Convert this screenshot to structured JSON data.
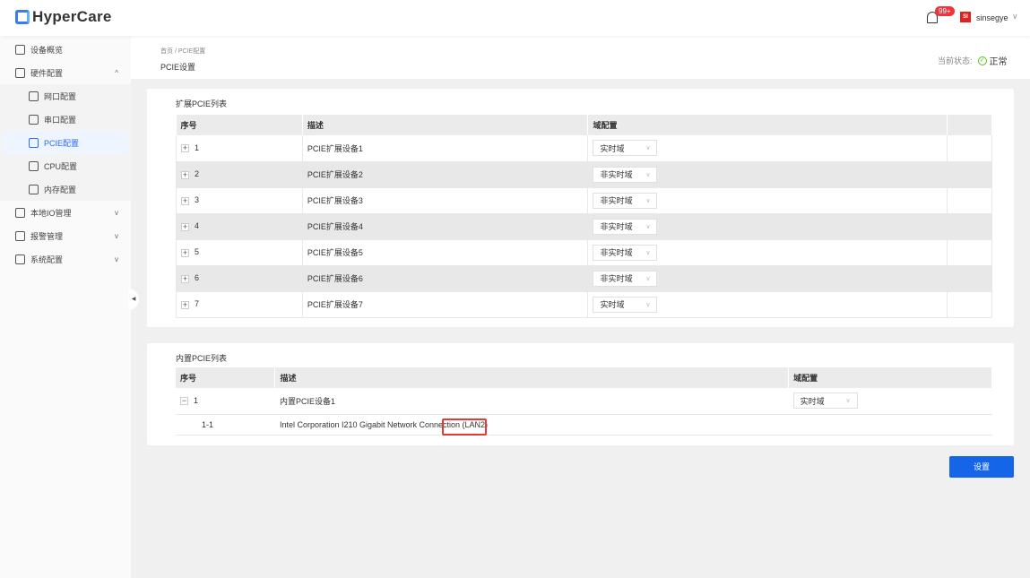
{
  "header": {
    "app_name": "HyperCare",
    "notification_count": "99+",
    "avatar_text": "SI",
    "username": "sinsegye"
  },
  "sidebar": {
    "items": [
      {
        "label": "设备概览"
      },
      {
        "label": "硬件配置"
      },
      {
        "label": "网口配置"
      },
      {
        "label": "串口配置"
      },
      {
        "label": "PCIE配置"
      },
      {
        "label": "CPU配置"
      },
      {
        "label": "内存配置"
      },
      {
        "label": "本地IO管理"
      },
      {
        "label": "报警管理"
      },
      {
        "label": "系统配置"
      }
    ]
  },
  "breadcrumb": {
    "home": "首页",
    "sep": "/",
    "current": "PCIE配置"
  },
  "page_title": "PCIE设置",
  "status": {
    "label": "当前状态:",
    "value": "正常"
  },
  "expansion": {
    "title": "扩展PCIE列表",
    "headers": [
      "序号",
      "描述",
      "域配置",
      ""
    ],
    "rows": [
      {
        "index": "1",
        "desc": "PCIE扩展设备1",
        "domain": "实时域"
      },
      {
        "index": "2",
        "desc": "PCIE扩展设备2",
        "domain": "非实时域"
      },
      {
        "index": "3",
        "desc": "PCIE扩展设备3",
        "domain": "非实时域"
      },
      {
        "index": "4",
        "desc": "PCIE扩展设备4",
        "domain": "非实时域"
      },
      {
        "index": "5",
        "desc": "PCIE扩展设备5",
        "domain": "非实时域"
      },
      {
        "index": "6",
        "desc": "PCIE扩展设备6",
        "domain": "非实时域"
      },
      {
        "index": "7",
        "desc": "PCIE扩展设备7",
        "domain": "实时域"
      }
    ]
  },
  "builtin": {
    "title": "内置PCIE列表",
    "headers": [
      "序号",
      "描述",
      "域配置"
    ],
    "rows": [
      {
        "index": "1",
        "desc": "内置PCIE设备1",
        "domain": "实时域"
      }
    ],
    "child": {
      "index": "1-1",
      "desc": "Intel Corporation I210 Gigabit Network Connection (LAN2)"
    }
  },
  "actions": {
    "submit": "设置"
  }
}
